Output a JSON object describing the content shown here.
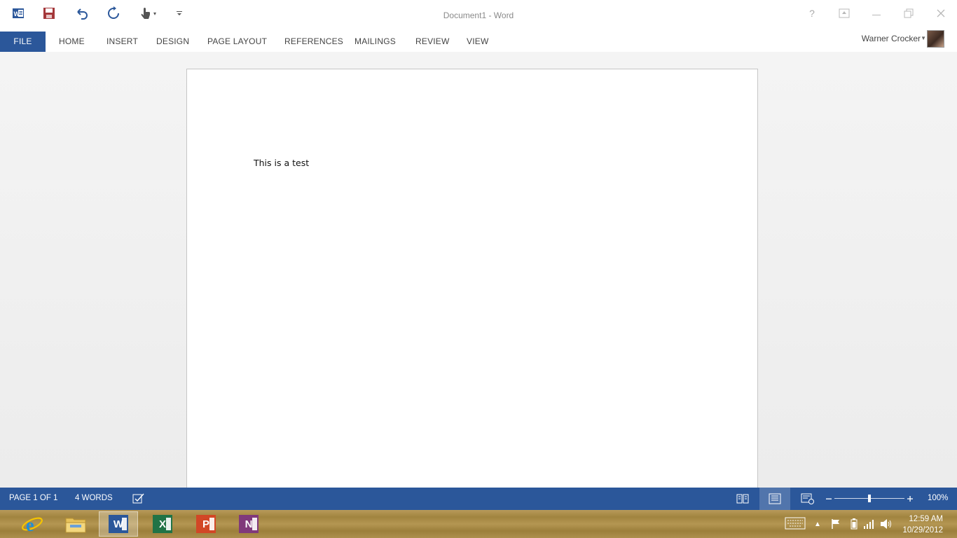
{
  "titlebar": {
    "title": "Document1 - Word",
    "help": "?",
    "quick_access": [
      "word-app-icon",
      "save-icon",
      "undo-icon",
      "redo-icon",
      "touch-mode-icon",
      "customize-toolbar-icon"
    ]
  },
  "ribbon": {
    "tabs": [
      "FILE",
      "HOME",
      "INSERT",
      "DESIGN",
      "PAGE LAYOUT",
      "REFERENCES",
      "MAILINGS",
      "REVIEW",
      "VIEW"
    ],
    "user_name": "Warner Crocker"
  },
  "document": {
    "text": "This is a test"
  },
  "statusbar": {
    "page": "PAGE 1 OF 1",
    "words": "4 WORDS",
    "zoom": "100%",
    "zoom_fraction": 0.5
  },
  "taskbar": {
    "apps": [
      "internet-explorer",
      "file-explorer",
      "word",
      "excel",
      "powerpoint",
      "onenote"
    ],
    "active_app": "word",
    "time": "12:59 AM",
    "date": "10/29/2012"
  },
  "colors": {
    "accent": "#2b579a",
    "word": "#2b579a",
    "excel": "#217346",
    "powerpoint": "#d24726",
    "onenote": "#80397b",
    "save_icon": "#a4373a"
  }
}
